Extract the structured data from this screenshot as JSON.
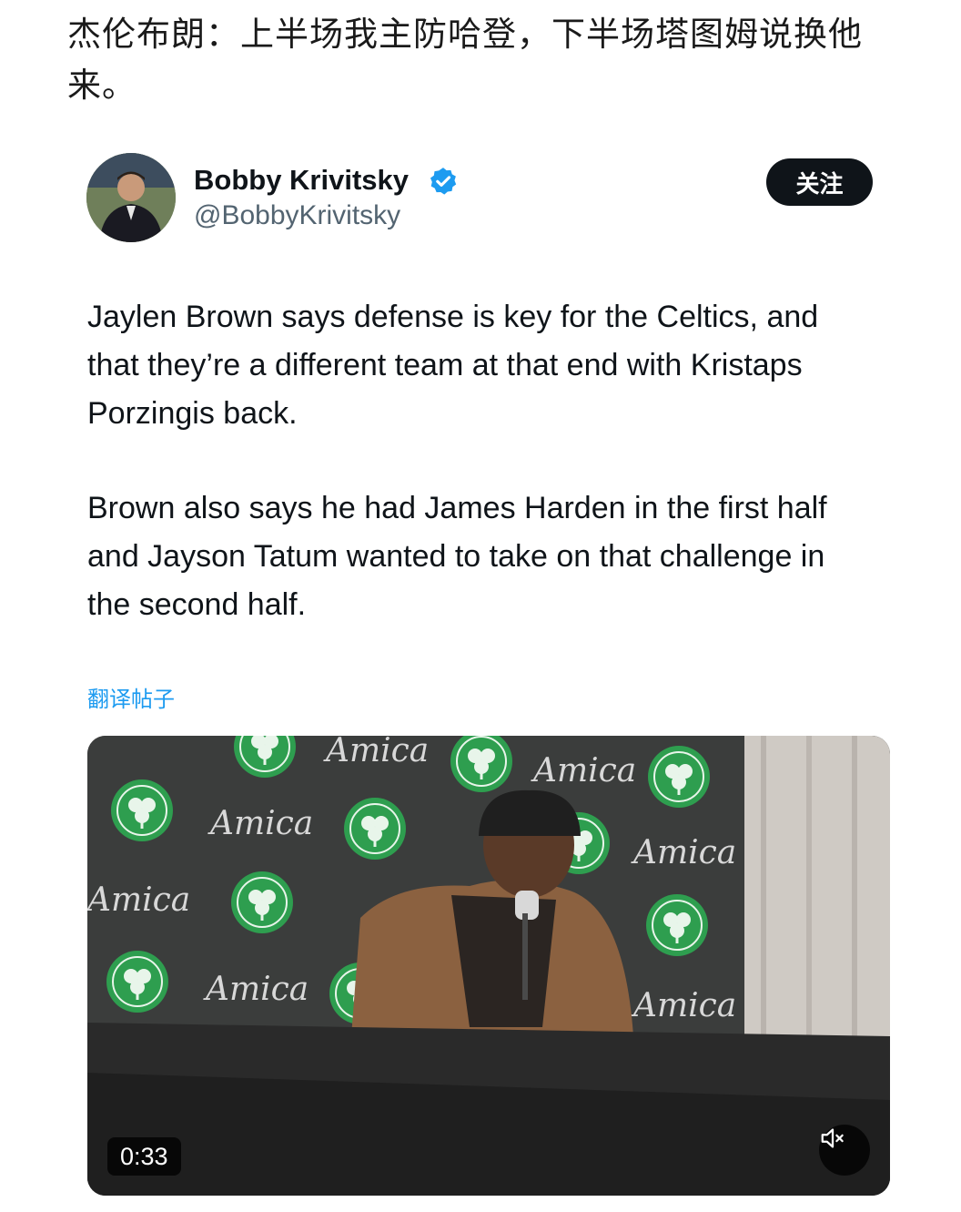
{
  "headline": "杰伦布朗：上半场我主防哈登，下半场塔图姆说换他来。",
  "tweet": {
    "author_name": "Bobby Krivitsky",
    "handle": "@BobbyKrivitsky",
    "follow_label": "关注",
    "paragraphs": [
      "Jaylen Brown says defense is key for the Celtics, and that they’re a different team at that end with Kristaps Porzingis back.",
      "Brown also says he had James Harden in the first half and Jayson Tatum wanted to take on that challenge in the second half."
    ],
    "translate_label": "翻译帖子"
  },
  "video": {
    "duration": "0:33",
    "backdrop_text": "Amica",
    "mute_icon": "speaker-muted-icon"
  },
  "colors": {
    "verified": "#1d9bf0",
    "link": "#1d9bf0",
    "follow_bg": "#0f1419",
    "celtics_green": "#2e9e4f"
  }
}
